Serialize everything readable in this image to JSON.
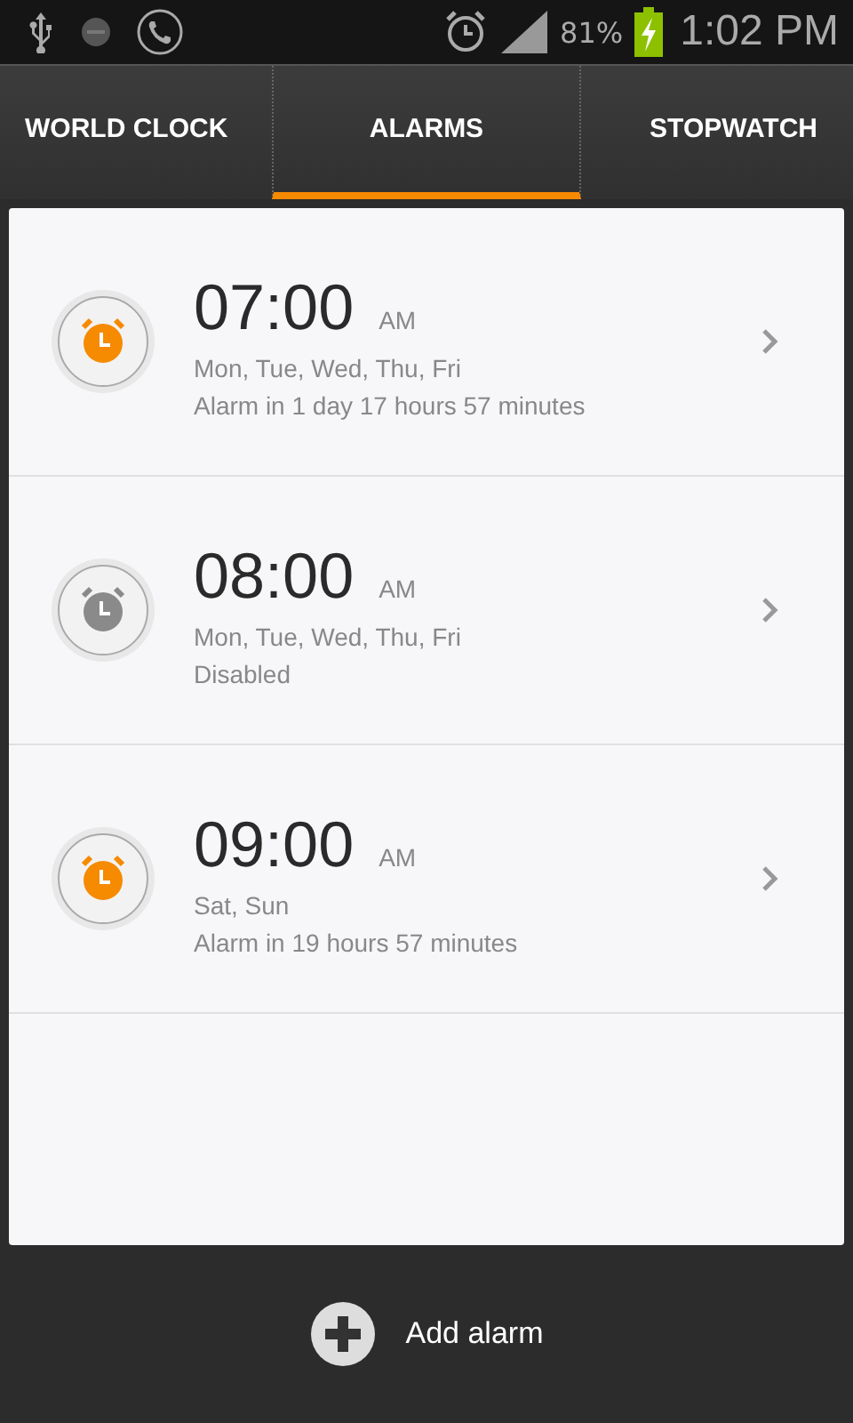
{
  "status_bar": {
    "battery": "81%",
    "time": "1:02 PM"
  },
  "tabs": [
    {
      "label": "WORLD CLOCK",
      "selected": false
    },
    {
      "label": "ALARMS",
      "selected": true
    },
    {
      "label": "STOPWATCH",
      "selected": false
    }
  ],
  "alarms": [
    {
      "time": "07:00",
      "period": "AM",
      "days": "Mon, Tue, Wed, Thu, Fri",
      "status": "Alarm in 1 day 17 hours 57 minutes",
      "enabled": true
    },
    {
      "time": "08:00",
      "period": "AM",
      "days": "Mon, Tue, Wed, Thu, Fri",
      "status": "Disabled",
      "enabled": false
    },
    {
      "time": "09:00",
      "period": "AM",
      "days": "Sat, Sun",
      "status": "Alarm in 19 hours 57 minutes",
      "enabled": true
    }
  ],
  "add_button": {
    "label": "Add alarm"
  }
}
